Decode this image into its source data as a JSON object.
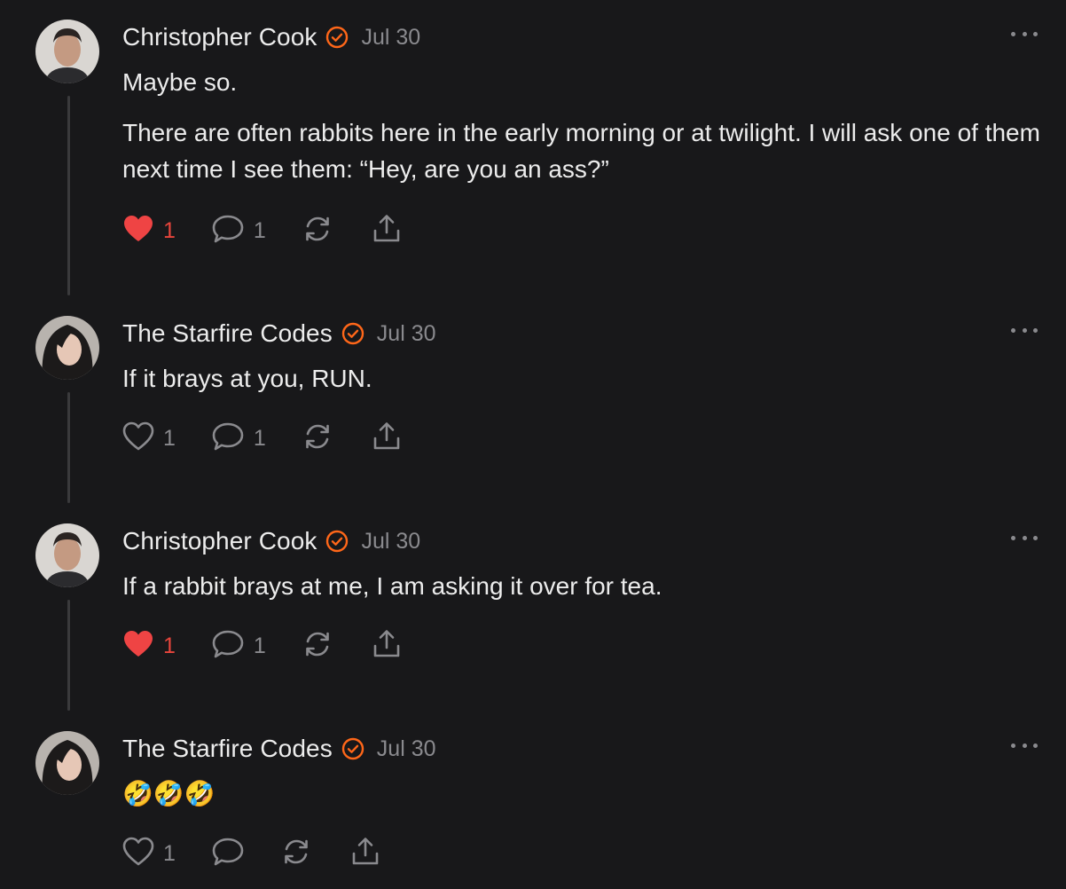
{
  "comments": [
    {
      "author": "Christopher Cook",
      "date": "Jul 30",
      "paragraphs": [
        "Maybe so.",
        "There are often rabbits here in the early morning or at twilight. I will ask one of them next time I see them: “Hey, are you an ass?”"
      ],
      "likes": "1",
      "liked": true,
      "replies": "1"
    },
    {
      "author": "The Starfire Codes",
      "date": "Jul 30",
      "paragraphs": [
        "If it brays at you, RUN."
      ],
      "likes": "1",
      "liked": false,
      "replies": "1"
    },
    {
      "author": "Christopher Cook",
      "date": "Jul 30",
      "paragraphs": [
        "If a rabbit brays at me, I am asking it over for tea."
      ],
      "likes": "1",
      "liked": true,
      "replies": "1"
    },
    {
      "author": "The Starfire Codes",
      "date": "Jul 30",
      "emoji_text": "🤣🤣🤣",
      "likes": "1",
      "liked": false,
      "replies": ""
    }
  ],
  "icons": {
    "verified": "verified-badge-icon",
    "more": "more-options-icon",
    "heart": "heart-icon",
    "comment": "comment-bubble-icon",
    "restack": "restack-icon",
    "share": "share-icon"
  },
  "colors": {
    "background": "#18181a",
    "accent": "#ff6719",
    "liked": "#e8453c",
    "muted": "#8a8a8e",
    "text": "#ececec"
  }
}
